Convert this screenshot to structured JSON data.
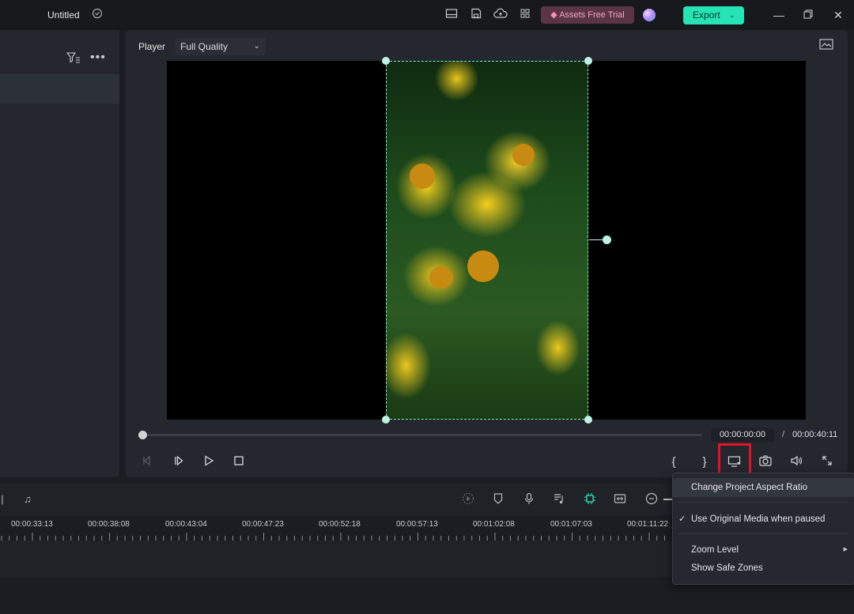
{
  "titlebar": {
    "title": "Untitled",
    "assets_label": "Assets Free Trial",
    "export_label": "Export",
    "icons": [
      "cloud-status-icon",
      "layout-icon",
      "save-icon",
      "cloud-upload-icon",
      "grid-icon"
    ]
  },
  "player": {
    "label": "Player",
    "quality": "Full Quality",
    "current_time": "00:00:00:00",
    "separator": "/",
    "total_time": "00:00:40:11",
    "progress": 0
  },
  "timeline": {
    "ticks": [
      "00:00:33:13",
      "00:00:38:08",
      "00:00:43:04",
      "00:00:47:23",
      "00:00:52:18",
      "00:00:57:13",
      "00:01:02:08",
      "00:01:07:03",
      "00:01:11:22"
    ]
  },
  "menu": {
    "items": [
      {
        "label": "Change Project Aspect Ratio",
        "highlighted": true
      },
      {
        "label": "Use Original Media when paused",
        "checked": true
      },
      {
        "label": "Zoom Level",
        "submenu": true
      },
      {
        "label": "Show Safe Zones"
      }
    ]
  },
  "colors": {
    "accent": "#26e3b6",
    "highlight_box": "#e4142b",
    "selection": "#7fe6cc"
  }
}
